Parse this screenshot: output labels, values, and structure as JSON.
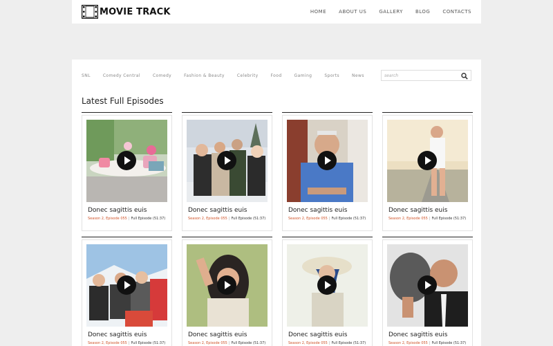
{
  "header": {
    "logo_text": "MOVIE TRACK",
    "nav": [
      "HOME",
      "ABOUT US",
      "GALLERY",
      "BLOG",
      "CONTACTS"
    ]
  },
  "categories": [
    "SNL",
    "Comedy Central",
    "Comedy",
    "Fashion & Beauty",
    "Celebrity",
    "Food",
    "Gaming",
    "Sports",
    "News"
  ],
  "search": {
    "placeholder": "search"
  },
  "section_title": "Latest Full Episodes",
  "episodes": [
    {
      "title": "Donec sagittis euis",
      "season": "Season 2, Episode 055",
      "full": "Full Episode (51:37)",
      "thumb": "tea-cups-on-table"
    },
    {
      "title": "Donec sagittis euis",
      "season": "Season 2, Episode 055",
      "full": "Full Episode (51:37)",
      "thumb": "friends-in-snow"
    },
    {
      "title": "Donec sagittis euis",
      "season": "Season 2, Episode 055",
      "full": "Full Episode (51:37)",
      "thumb": "older-man-blue-shirt"
    },
    {
      "title": "Donec sagittis euis",
      "season": "Season 2, Episode 055",
      "full": "Full Episode (51:37)",
      "thumb": "woman-on-road"
    },
    {
      "title": "Donec sagittis euis",
      "season": "Season 2, Episode 055",
      "full": "Full Episode (51:37)",
      "thumb": "skiers-group"
    },
    {
      "title": "Donec sagittis euis",
      "season": "Season 2, Episode 055",
      "full": "Full Episode (51:37)",
      "thumb": "woman-posing"
    },
    {
      "title": "Donec sagittis euis",
      "season": "Season 2, Episode 055",
      "full": "Full Episode (51:37)",
      "thumb": "woman-sun-hat"
    },
    {
      "title": "Donec sagittis euis",
      "season": "Season 2, Episode 055",
      "full": "Full Episode (51:37)",
      "thumb": "man-with-hat"
    }
  ],
  "colors": {
    "accent": "#d0542a",
    "background": "#eeeeee",
    "panel": "#ffffff"
  }
}
